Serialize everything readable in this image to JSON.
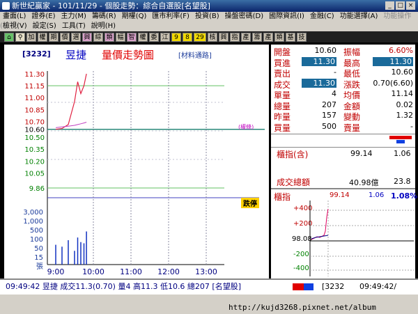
{
  "window": {
    "title": "新世紀贏家 - 101/11/29 - 個股走勢：綜合自選股[名望股]"
  },
  "menu1": [
    "畫面(L)",
    "證券(E)",
    "主力(M)",
    "籌碼(R)",
    "期權(Q)",
    "匯市利率(F)",
    "投資(B)",
    "操盤密碼(D)",
    "國際資訊(I)",
    "金融(C)",
    "功能選擇(A)",
    "功能操作(I)"
  ],
  "menu2": [
    "檢視(V)",
    "設定(S)",
    "工具(T)",
    "說明(H)"
  ],
  "toolbar": [
    "加",
    "權",
    "期",
    "價",
    "選",
    "興",
    "綜",
    "類",
    "幅",
    "智",
    "權",
    "委",
    "江",
    "9",
    "8",
    "29",
    "核",
    "興",
    "指",
    "產",
    "籌",
    "產",
    "類",
    "基",
    "技"
  ],
  "chart": {
    "code": "[3232]",
    "name": "昱捷",
    "title": "量價走勢圖",
    "link": "[材料通路]",
    "price_ticks": [
      "11.30",
      "11.15",
      "11.00",
      "10.85",
      "10.70",
      "10.60",
      "10.50",
      "10.35",
      "10.20",
      "10.05",
      "9.86"
    ],
    "ref_label": "(權條)",
    "limit_down_badge": "跌停",
    "volume_ticks": [
      "3,000",
      "1,000",
      "500",
      "100",
      "50",
      "15",
      "張"
    ],
    "time_ticks": [
      "9:00",
      "10:00",
      "11:00",
      "12:00",
      "13:00"
    ]
  },
  "chart_data": {
    "type": "line",
    "title": "量價走勢圖",
    "xlabel": "",
    "ylabel": "",
    "x": [
      "09:00",
      "09:10",
      "09:20",
      "09:30",
      "09:35",
      "09:40",
      "09:45",
      "09:49"
    ],
    "series": [
      {
        "values": [
          10.6,
          10.61,
          10.66,
          10.95,
          11.2,
          11.05,
          11.15,
          11.3
        ]
      }
    ],
    "volume": [
      20,
      15,
      40,
      8,
      60,
      30,
      25,
      150
    ],
    "ylim": [
      9.86,
      11.3
    ],
    "reference_price": 10.6
  },
  "quote": {
    "rows": [
      [
        "開盤",
        "10.60",
        "振幅",
        "6.60%"
      ],
      [
        "買進",
        "11.30",
        "最高",
        "11.30"
      ],
      [
        "賣出",
        "-",
        "最低",
        "10.60"
      ],
      [
        "成交",
        "11.30",
        "漲跌",
        "0.70(6.60)"
      ],
      [
        "單量",
        "4",
        "均價",
        "11.14"
      ],
      [
        "總量",
        "207",
        "金額",
        "0.02"
      ],
      [
        "昨量",
        "157",
        "變動",
        "1.32"
      ],
      [
        "買量",
        "500",
        "賣量",
        "-"
      ]
    ]
  },
  "index": {
    "label": "櫃指(含)",
    "value": "99.14",
    "change": "1.06",
    "turnover_label": "成交總額",
    "turnover": "40.98億",
    "turnover_change": "23.8"
  },
  "mini": {
    "label": "櫃指",
    "value": "99.14",
    "change": "1.06",
    "pct": "1.08%",
    "ticks": [
      "+400",
      "+200",
      "98.08",
      "-200",
      "-400"
    ]
  },
  "bottom": {
    "text": "09:49:42  昱捷  成交11.3(0.70)  量4  高11.3  低10.6  總207  [名望股]",
    "code": "[3232",
    "time": "09:49:42/"
  },
  "statusbar": {
    "url": "http://kujd3268.pixnet.net/album"
  }
}
